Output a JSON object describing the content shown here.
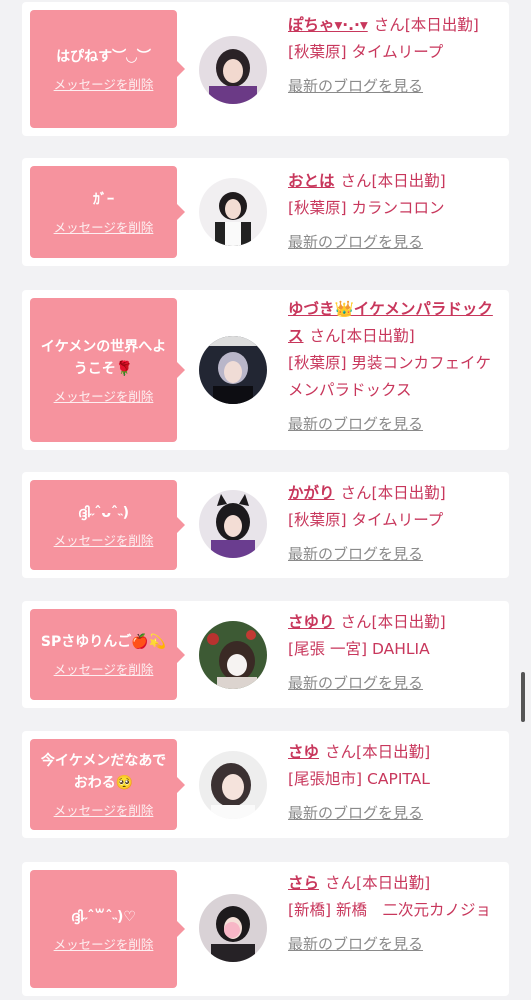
{
  "cards": [
    {
      "message": "はぴねす︶◡︶",
      "delete_label": "メッセージを削除",
      "name": "ぽちゃ▾·.·▾",
      "san": "さん",
      "status": "[本日出勤]",
      "area": "[秋葉原]",
      "shop": "タイムリープ",
      "blog_label": "最新のブログを見る"
    },
    {
      "message": "ｶﾞｰ",
      "delete_label": "メッセージを削除",
      "name": "おとは",
      "san": "さん",
      "status": "[本日出勤]",
      "area": "[秋葉原]",
      "shop": "カランコロン",
      "blog_label": "最新のブログを見る"
    },
    {
      "message": "イケメンの世界へようこそ🌹",
      "delete_label": "メッセージを削除",
      "name": "ゆづき👑イケメンパラドックス",
      "san": "さん",
      "status": "[本日出勤]",
      "area": "[秋葉原]",
      "shop": "男装コンカフェイケメンパラドックス",
      "blog_label": "最新のブログを見る"
    },
    {
      "message": "ദ്ദി˶ˆᴗˆ˵)",
      "delete_label": "メッセージを削除",
      "name": "かがり",
      "san": "さん",
      "status": "[本日出勤]",
      "area": "[秋葉原]",
      "shop": "タイムリープ",
      "blog_label": "最新のブログを見る"
    },
    {
      "message": "SPさゆりんご🍎💫",
      "delete_label": "メッセージを削除",
      "name": "さゆり",
      "san": "さん",
      "status": "[本日出勤]",
      "area": "[尾張 一宮]",
      "shop": "DAHLIA",
      "blog_label": "最新のブログを見る"
    },
    {
      "message": "今イケメンだなあでおわる🥺",
      "delete_label": "メッセージを削除",
      "name": "さゆ",
      "san": "さん",
      "status": "[本日出勤]",
      "area": "[尾張旭市]",
      "shop": "CAPITAL",
      "blog_label": "最新のブログを見る"
    },
    {
      "message": "ദ്ദി˶ˆ꒳ˆ˵)♡",
      "delete_label": "メッセージを削除",
      "name": "さら",
      "san": "さん",
      "status": "[本日出勤]",
      "area": "[新橋]",
      "shop": "新橋　二次元カノジョ",
      "blog_label": "最新のブログを見る"
    }
  ],
  "colors": {
    "accent": "#c8375c",
    "bubble": "#f6939e",
    "link_gray": "#8a8a8a"
  }
}
